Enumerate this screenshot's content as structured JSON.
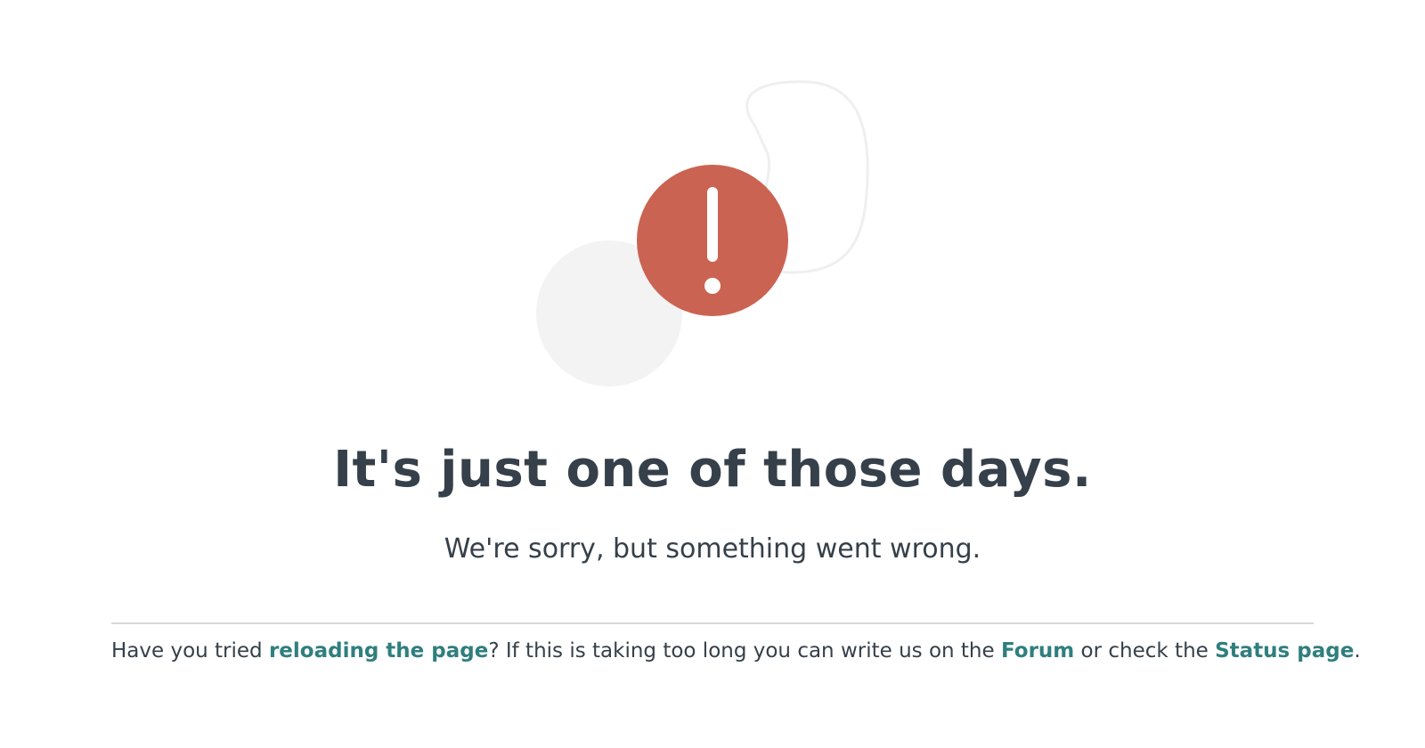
{
  "error": {
    "icon": "exclamation-icon",
    "accent_color": "#cb6352",
    "headline": "It's just one of those days.",
    "subline": "We're sorry, but something went wrong."
  },
  "help": {
    "text_before_reload": "Have you tried ",
    "reload_link": "reloading the page",
    "text_after_reload": "? If this is taking too long you can write us on the ",
    "forum_link": "Forum",
    "text_before_status": " or check the ",
    "status_link": "Status page",
    "text_end": ".",
    "link_color": "#2f7f7e"
  }
}
